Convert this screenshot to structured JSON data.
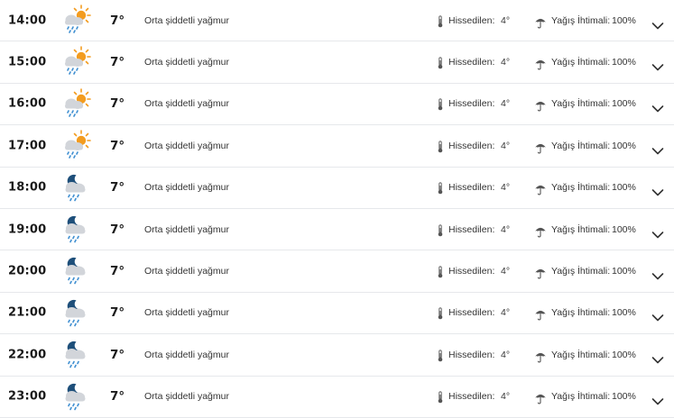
{
  "forecast": {
    "feels_label": "Hissedilen:",
    "rain_label": "Yağış İhtimali:",
    "colors": {
      "sun": "#f39c1f",
      "moon": "#1e4f7a",
      "cloud": "#d2d5da",
      "rain": "#3f8fd1",
      "divider": "#e6e8eb"
    },
    "rows": [
      {
        "time": "14:00",
        "icon": "partly-sunny-rain-icon",
        "temp": "7°",
        "desc": "Orta şiddetli yağmur",
        "feels": "4°",
        "rain": "100%"
      },
      {
        "time": "15:00",
        "icon": "partly-sunny-rain-icon",
        "temp": "7°",
        "desc": "Orta şiddetli yağmur",
        "feels": "4°",
        "rain": "100%"
      },
      {
        "time": "16:00",
        "icon": "partly-sunny-rain-icon",
        "temp": "7°",
        "desc": "Orta şiddetli yağmur",
        "feels": "4°",
        "rain": "100%"
      },
      {
        "time": "17:00",
        "icon": "partly-sunny-rain-icon",
        "temp": "7°",
        "desc": "Orta şiddetli yağmur",
        "feels": "4°",
        "rain": "100%"
      },
      {
        "time": "18:00",
        "icon": "night-rain-icon",
        "temp": "7°",
        "desc": "Orta şiddetli yağmur",
        "feels": "4°",
        "rain": "100%"
      },
      {
        "time": "19:00",
        "icon": "night-rain-icon",
        "temp": "7°",
        "desc": "Orta şiddetli yağmur",
        "feels": "4°",
        "rain": "100%"
      },
      {
        "time": "20:00",
        "icon": "night-rain-icon",
        "temp": "7°",
        "desc": "Orta şiddetli yağmur",
        "feels": "4°",
        "rain": "100%"
      },
      {
        "time": "21:00",
        "icon": "night-rain-icon",
        "temp": "7°",
        "desc": "Orta şiddetli yağmur",
        "feels": "4°",
        "rain": "100%"
      },
      {
        "time": "22:00",
        "icon": "night-rain-icon",
        "temp": "7°",
        "desc": "Orta şiddetli yağmur",
        "feels": "4°",
        "rain": "100%"
      },
      {
        "time": "23:00",
        "icon": "night-rain-icon",
        "temp": "7°",
        "desc": "Orta şiddetli yağmur",
        "feels": "4°",
        "rain": "100%"
      }
    ]
  }
}
